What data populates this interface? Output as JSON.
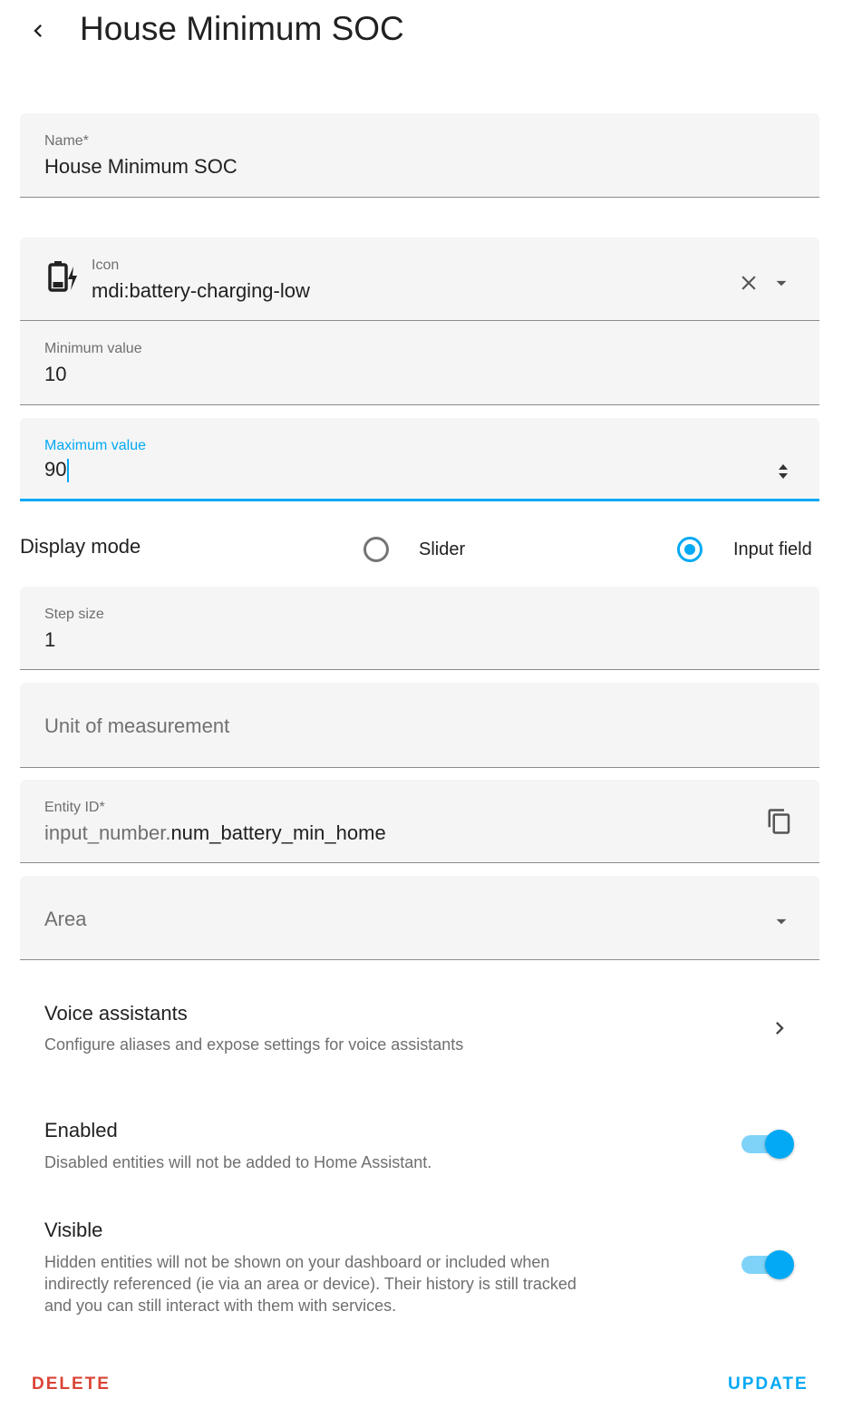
{
  "header": {
    "title": "House Minimum SOC"
  },
  "form": {
    "name": {
      "label": "Name*",
      "value": "House Minimum SOC"
    },
    "icon": {
      "label": "Icon",
      "value": "mdi:battery-charging-low"
    },
    "min_value": {
      "label": "Minimum value",
      "value": "10"
    },
    "max_value": {
      "label": "Maximum value",
      "value": "90"
    },
    "display_mode": {
      "label": "Display mode",
      "options": [
        "Slider",
        "Input field"
      ],
      "selected": "Input field"
    },
    "step": {
      "label": "Step size",
      "value": "1"
    },
    "unit": {
      "placeholder": "Unit of measurement",
      "value": ""
    },
    "entity_id": {
      "label": "Entity ID*",
      "prefix": "input_number.",
      "value": "num_battery_min_home"
    },
    "area": {
      "placeholder": "Area"
    }
  },
  "voice": {
    "title": "Voice assistants",
    "subtitle": "Configure aliases and expose settings for voice assistants"
  },
  "enabled": {
    "title": "Enabled",
    "subtitle": "Disabled entities will not be added to Home Assistant.",
    "on": true
  },
  "visible": {
    "title": "Visible",
    "subtitle_lines": [
      "Hidden entities will not be shown on your dashboard or included when",
      "indirectly referenced (ie via an area or device). Their history is still tracked",
      "and you can still interact with them with services."
    ],
    "on": true
  },
  "actions": {
    "delete": "DELETE",
    "update": "UPDATE"
  },
  "colors": {
    "accent": "#03a9f4",
    "danger": "#db4437",
    "field_bg": "#f5f5f5"
  },
  "icons": {
    "back": "chevron-left-icon",
    "entity_icon": "battery-charging-low-icon",
    "clear": "close-icon",
    "dropdown": "menu-down-icon",
    "spinner": "spin-arrows-icon",
    "copy": "content-copy-icon",
    "chevron": "chevron-right-icon"
  }
}
